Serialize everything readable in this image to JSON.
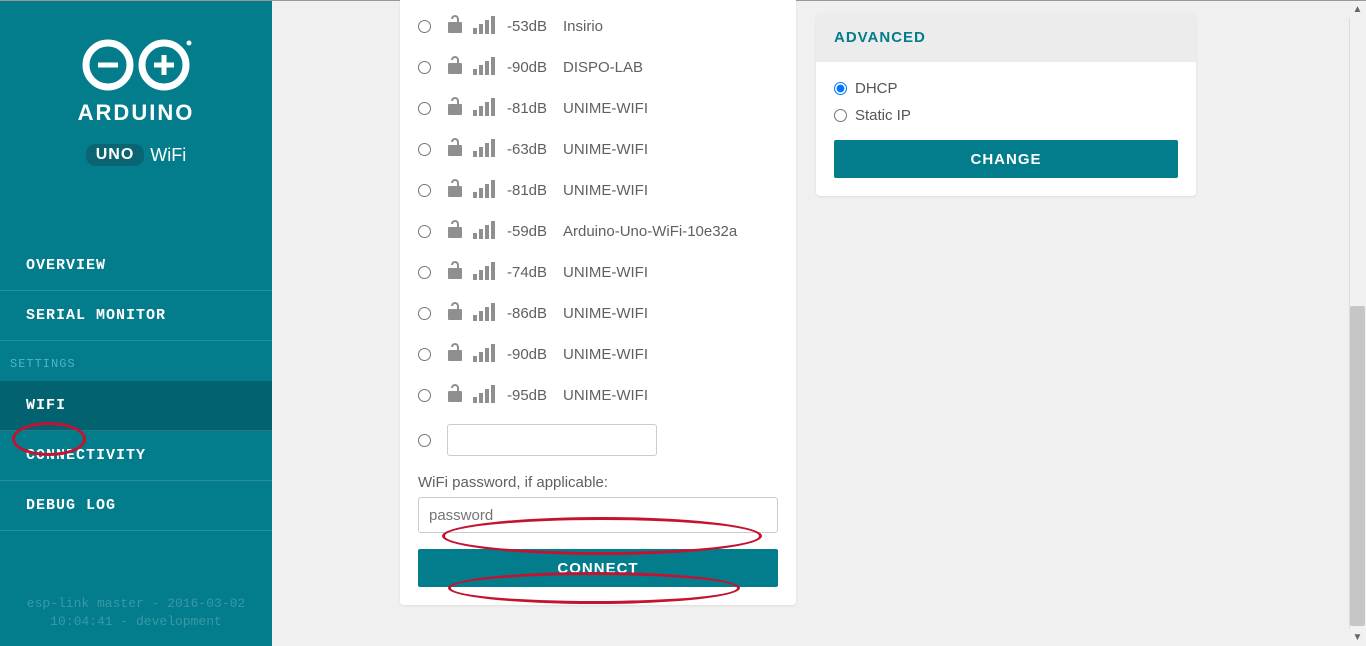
{
  "brand": {
    "name": "ARDUINO",
    "model_badge": "UNO",
    "model_suffix": "WiFi"
  },
  "sidebar": {
    "items": [
      {
        "label": "OVERVIEW"
      },
      {
        "label": "SERIAL MONITOR"
      }
    ],
    "section_label": "SETTINGS",
    "settings_items": [
      {
        "label": "WIFI",
        "active": true
      },
      {
        "label": "CONNECTIVITY"
      },
      {
        "label": "DEBUG LOG"
      }
    ],
    "footer_line1": "esp-link master - 2016-03-02",
    "footer_line2": "10:04:41 - development"
  },
  "wifi": {
    "networks": [
      {
        "db": "-53dB",
        "ssid": "Insirio"
      },
      {
        "db": "-90dB",
        "ssid": "DISPO-LAB"
      },
      {
        "db": "-81dB",
        "ssid": "UNIME-WIFI"
      },
      {
        "db": "-63dB",
        "ssid": "UNIME-WIFI"
      },
      {
        "db": "-81dB",
        "ssid": "UNIME-WIFI"
      },
      {
        "db": "-59dB",
        "ssid": "Arduino-Uno-WiFi-10e32a"
      },
      {
        "db": "-74dB",
        "ssid": "UNIME-WIFI"
      },
      {
        "db": "-86dB",
        "ssid": "UNIME-WIFI"
      },
      {
        "db": "-90dB",
        "ssid": "UNIME-WIFI"
      },
      {
        "db": "-95dB",
        "ssid": "UNIME-WIFI"
      }
    ],
    "password_label": "WiFi password, if applicable:",
    "password_placeholder": "password",
    "connect_label": "CONNECT"
  },
  "advanced": {
    "title": "ADVANCED",
    "options": [
      {
        "label": "DHCP",
        "checked": true
      },
      {
        "label": "Static IP",
        "checked": false
      }
    ],
    "change_label": "CHANGE"
  }
}
